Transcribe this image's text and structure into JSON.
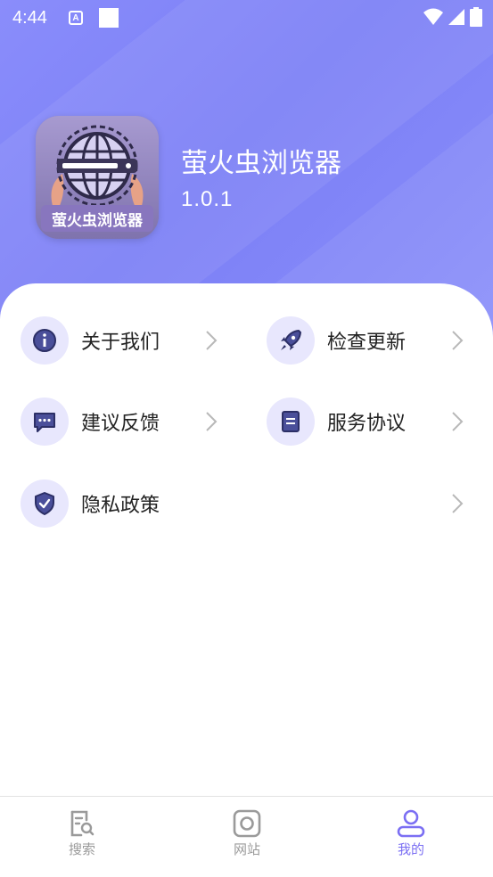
{
  "status_bar": {
    "time": "4:44",
    "notification_icon_letter": "A"
  },
  "app": {
    "name": "萤火虫浏览器",
    "version": "1.0.1",
    "logo_text": "萤火虫浏览器"
  },
  "menu": {
    "about": "关于我们",
    "check_update": "检查更新",
    "feedback": "建议反馈",
    "service": "服务协议",
    "privacy": "隐私政策"
  },
  "bottom_nav": {
    "search": "搜索",
    "website": "网站",
    "mine": "我的",
    "active": "mine"
  },
  "colors": {
    "accent": "#7b6ff3",
    "icon_bg": "#e8e7fd",
    "icon_fg": "#3a3f7a",
    "header": "#8a8dfb"
  }
}
